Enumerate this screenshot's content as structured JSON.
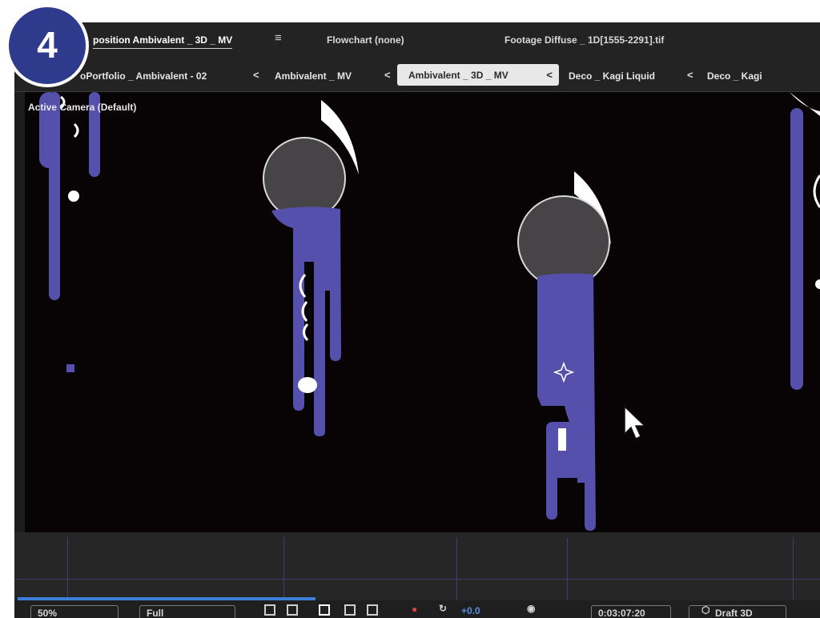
{
  "step_badge": "4",
  "panel_tabs": {
    "composition": "position Ambivalent _ 3D _ MV",
    "flowchart": "Flowchart (none)",
    "footage": "Footage Diffuse _ 1D[1555-2291].tif"
  },
  "breadcrumbs": {
    "items": [
      "oPortfolio _ Ambivalent - 02",
      "Ambivalent _ MV",
      "Ambivalent _ 3D _ MV",
      "Deco _ Kagi Liquid",
      "Deco _ Kagi"
    ],
    "separator": "<",
    "current_index": 2
  },
  "viewer": {
    "camera_label": "Active Camera (Default)"
  },
  "toolbar": {
    "zoom": "50%",
    "resolution": "Full",
    "exposure": "+0.0",
    "timecode": "0:03:07:20",
    "renderer": "Draft 3D"
  },
  "colors": {
    "liquid": "#5650ad",
    "ball": "#464446",
    "badge": "#2e3a8c",
    "progress": "#3d7fd8"
  },
  "icons": [
    "menu-icon",
    "chevron-left-icon",
    "cursor-icon",
    "anchor-point-icon",
    "camera-icon",
    "cube-icon"
  ]
}
